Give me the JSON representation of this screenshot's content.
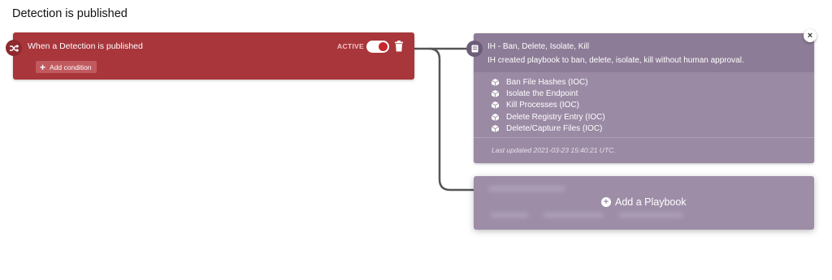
{
  "page": {
    "title": "Detection is published"
  },
  "trigger": {
    "title": "When a Detection is published",
    "status_label": "ACTIVE",
    "toggle_on": true,
    "add_condition_label": "Add condition",
    "color": "#a8363b"
  },
  "playbook": {
    "title": "IH - Ban, Delete, Isolate, Kill",
    "description": "IH created playbook to ban, delete, isolate, kill without human approval.",
    "actions": [
      "Ban File Hashes (IOC)",
      "Isolate the Endpoint",
      "Kill Processes (IOC)",
      "Delete Registry Entry (IOC)",
      "Delete/Capture Files (IOC)"
    ],
    "last_updated": "Last updated 2021-03-23 15:40:21 UTC.",
    "color": "#8d7c97"
  },
  "add_playbook": {
    "label": "Add a Playbook"
  }
}
